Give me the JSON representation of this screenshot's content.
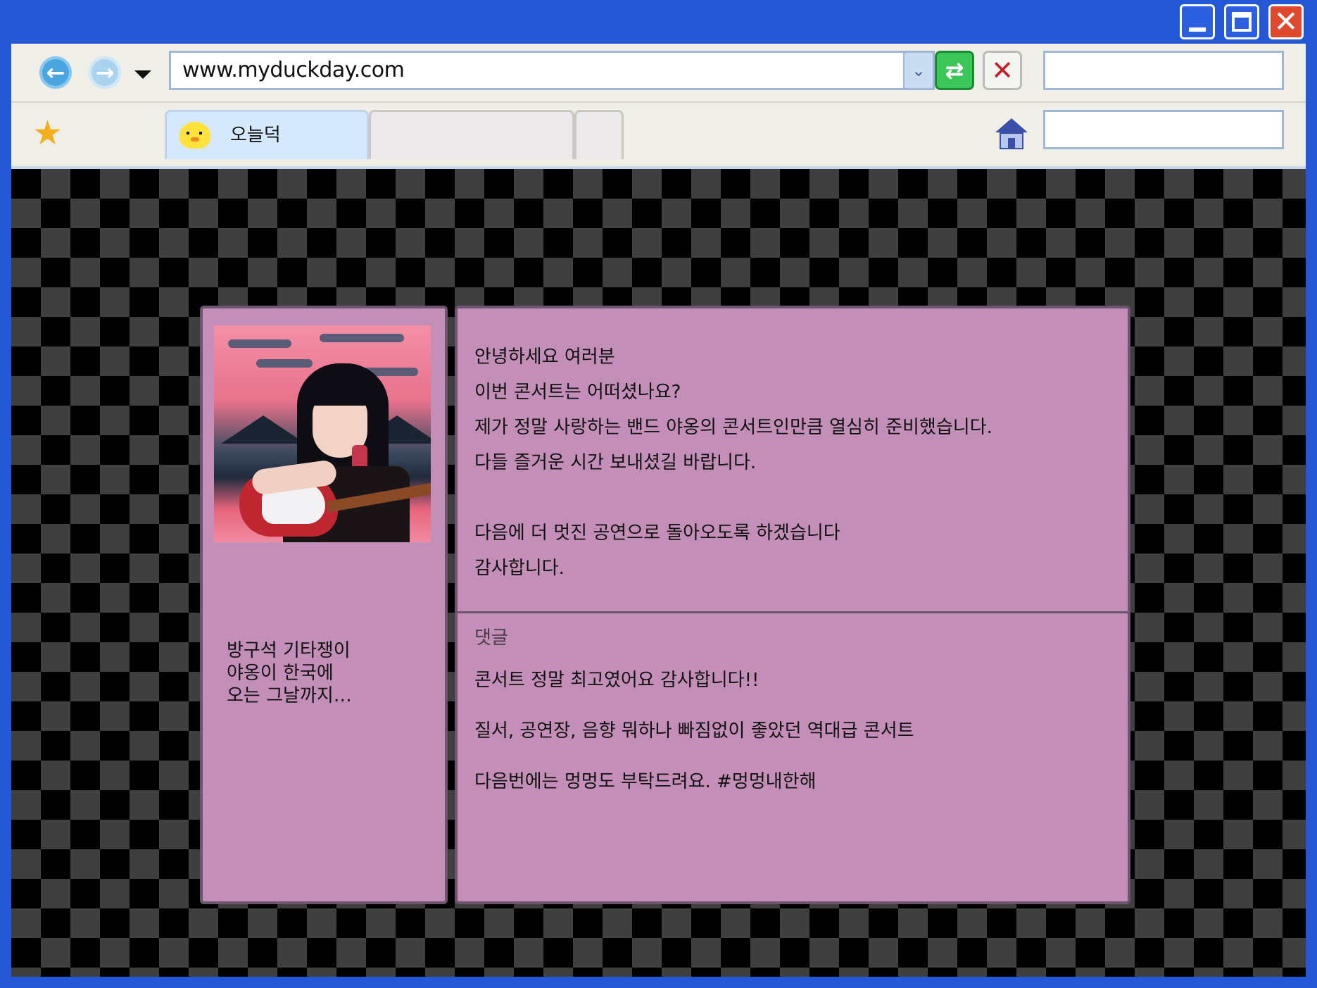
{
  "browser": {
    "url": "www.myduckday.com",
    "tabs": [
      {
        "label": "오늘덕",
        "active": true
      },
      {
        "label": "",
        "active": false
      },
      {
        "label": "",
        "active": false
      }
    ]
  },
  "profile": {
    "bio": [
      "방구석 기타쟁이",
      "야옹이 한국에",
      "오는 그날까지…"
    ]
  },
  "post": {
    "lines": [
      "안녕하세요 여러분",
      "이번 콘서트는 어떠셨나요?",
      "제가 정말 사랑하는 밴드 야옹의 콘서트인만큼 열심히 준비했습니다.",
      "다들 즐거운 시간 보내셨길 바랍니다.",
      "",
      "다음에 더 멋진 공연으로 돌아오도록 하겠습니다",
      "감사합니다."
    ]
  },
  "comments": {
    "title": "댓글",
    "items": [
      "콘서트 정말 최고였어요 감사합니다!!",
      "질서, 공연장, 음향 뭐하나 빠짐없이 좋았던 역대급 콘서트",
      "다음번에는 멍멍도 부탁드려요. #멍멍내한해"
    ]
  },
  "icons": {
    "back": "back-arrow-icon",
    "forward": "forward-arrow-icon",
    "refresh": "refresh-icon",
    "stop": "close-icon",
    "favorite": "star-icon",
    "home": "home-icon",
    "tab": "duck-icon"
  },
  "colors": {
    "frame": "#2457d6",
    "panel": "#c38fb8",
    "panel_border": "#6d5570",
    "checker_light": "#3f3f3f",
    "checker_dark": "#000000"
  }
}
